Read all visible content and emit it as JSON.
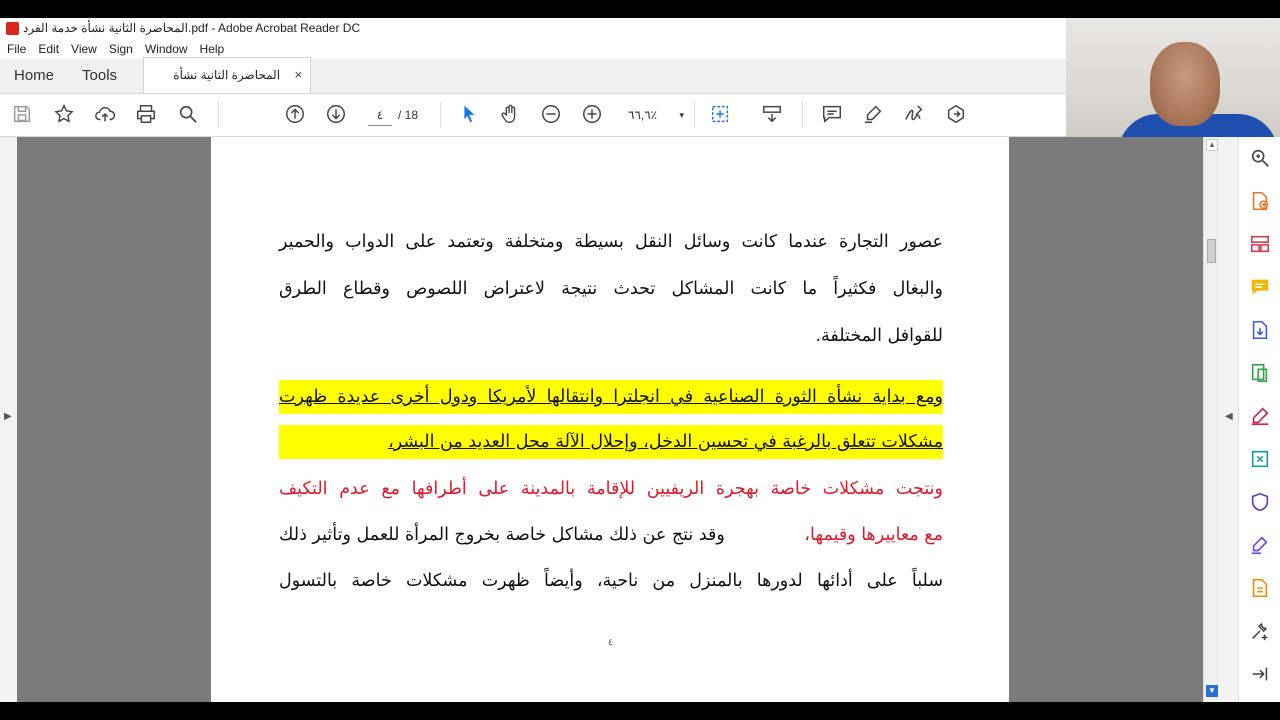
{
  "window": {
    "title": "المحاضرة الثانية نشأة خدمة الفرد.pdf - Adobe Acrobat Reader DC"
  },
  "menu": [
    "File",
    "Edit",
    "View",
    "Sign",
    "Window",
    "Help"
  ],
  "tabs": {
    "home": "Home",
    "tools": "Tools",
    "document": "المحاضرة الثانية نشأة خدم...",
    "close": "×"
  },
  "toolbar": {
    "page_current": "٤",
    "page_total": "/ 18",
    "zoom": "٦٦,٦٪",
    "zoom_caret": "▾"
  },
  "document": {
    "lines": [
      "عصور التجارة عندما كانت وسائل النقل بسيطة ومتخلفة وتعتمد على الدواب والحمير",
      "والبغال فكثيراً ما كانت المشاكل تحدث نتيجة لاعتراض اللصوص وقطاع الطرق",
      "للقوافل المختلفة.",
      "ومع بداية نشأة الثورة الصناعية في انجلترا وانتقالها لأمريكا ودول أخرى عديدة ظهرت",
      "مشكلات تتعلق بالرغبة في تحسين الدخل، وإحلال الآلة محل العديد من البشر،",
      "ونتجت مشكلات خاصة بهجرة الريفيين للإقامة بالمدينة على أطرافها مع عدم التكيف",
      "مع معاييرها وقيمها،",
      " وقد نتج عن ذلك مشاكل خاصة بخروج المرأة للعمل وتأثير ذلك",
      "سلباً على أدائها لدورها بالمنزل من ناحية، وأيضاً ظهرت مشكلات خاصة بالتسول"
    ],
    "page_footer": "٤"
  },
  "colors": {
    "highlight": "#ffff00",
    "red_text": "#e0182a",
    "acrobat_red": "#d9261c"
  },
  "icons": {
    "toolbar": [
      "save-icon",
      "bookmark-star-icon",
      "upload-cloud-icon",
      "print-icon",
      "zoom-search-icon",
      "page-up-icon",
      "page-down-icon",
      "select-arrow-icon",
      "hand-icon",
      "zoom-out-icon",
      "zoom-in-icon",
      "fit-page-icon",
      "scroll-mode-icon",
      "comment-icon",
      "highlight-pen-icon",
      "sign-icon",
      "share-icon"
    ],
    "right_panel": [
      "search-panel-icon",
      "export-pdf-icon",
      "organize-pages-icon",
      "comment-panel-icon",
      "create-pdf-icon",
      "edit-pdf-icon",
      "fill-sign-icon",
      "compress-icon",
      "protect-icon",
      "send-for-signature-icon",
      "more-tools-icon",
      "add-tools-icon",
      "collapse-panel-icon"
    ]
  }
}
